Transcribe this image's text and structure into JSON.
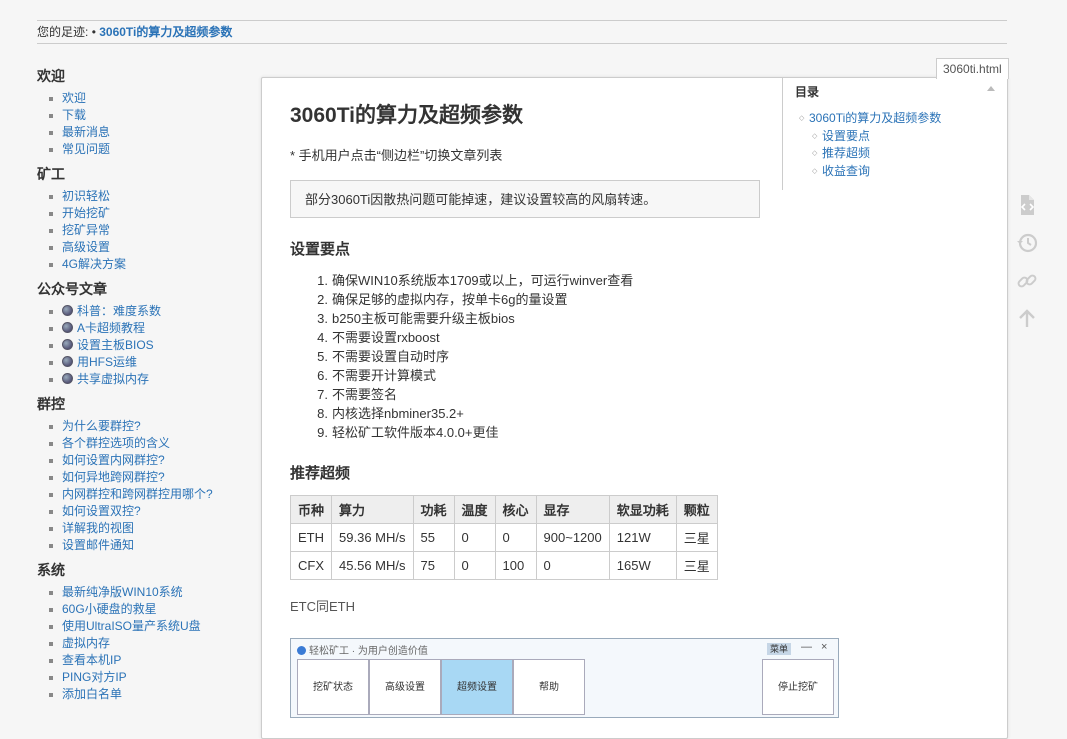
{
  "breadcrumb": {
    "label": "您的足迹:",
    "separator": "•",
    "current": "3060Ti的算力及超频参数"
  },
  "filename_tab": "3060ti.html",
  "sidebar": [
    {
      "heading": "欢迎",
      "items": [
        "欢迎",
        "下载",
        "最新消息",
        "常见问题"
      ]
    },
    {
      "heading": "矿工",
      "items": [
        "初识轻松",
        "开始挖矿",
        "挖矿异常",
        "高级设置",
        "4G解决方案"
      ]
    },
    {
      "heading": "公众号文章",
      "items": [
        "科普：难度系数",
        "A卡超频教程",
        "设置主板BIOS",
        "用HFS运维",
        "共享虚拟内存"
      ],
      "with_globe_icon": true
    },
    {
      "heading": "群控",
      "items": [
        "为什么要群控?",
        "各个群控选项的含义",
        "如何设置内网群控?",
        "如何异地跨网群控?",
        "内网群控和跨网群控用哪个?",
        "如何设置双控?",
        "详解我的视图",
        "设置邮件通知"
      ]
    },
    {
      "heading": "系统",
      "items": [
        "最新纯净版WIN10系统",
        "60G小硬盘的救星",
        "使用UltraISO量产系统U盘",
        "虚拟内存",
        "查看本机IP",
        "PING对方IP",
        "添加白名单"
      ]
    }
  ],
  "content": {
    "title": "3060Ti的算力及超频参数",
    "mobile_note": "* 手机用户点击“侧边栏”切换文章列表",
    "warning": "部分3060Ti因散热问题可能掉速，建议设置较高的风扇转速。",
    "section1_title": "设置要点",
    "settings_points": [
      "确保WIN10系统版本1709或以上，可运行winver查看",
      "确保足够的虚拟内存，按单卡6g的量设置",
      "b250主板可能需要升级主板bios",
      "不需要设置rxboost",
      "不需要设置自动时序",
      "不需要开计算模式",
      "不需要签名",
      "内核选择nbminer35.2+",
      "轻松矿工软件版本4.0.0+更佳"
    ],
    "section2_title": "推荐超频",
    "table": {
      "headers": [
        "币种",
        "算力",
        "功耗",
        "温度",
        "核心",
        "显存",
        "软显功耗",
        "颗粒"
      ],
      "rows": [
        [
          "ETH",
          "59.36 MH/s",
          "55",
          "0",
          "0",
          "900~1200",
          "121W",
          "三星"
        ],
        [
          "CFX",
          "45.56 MH/s",
          "75",
          "0",
          "100",
          "0",
          "165W",
          "三星"
        ]
      ]
    },
    "etc_note": "ETC同ETH"
  },
  "app_screenshot": {
    "title": "轻松矿工 · 为用户创造价值",
    "menu_label": "菜单",
    "minimize": "—",
    "close": "×",
    "tabs": [
      "挖矿状态",
      "高级设置",
      "超频设置",
      "帮助"
    ],
    "active_tab": "超频设置",
    "stop_button": "停止挖矿"
  },
  "toc": {
    "heading": "目录",
    "items": [
      {
        "label": "3060Ti的算力及超频参数",
        "level": 1
      },
      {
        "label": "设置要点",
        "level": 2
      },
      {
        "label": "推荐超频",
        "level": 2
      },
      {
        "label": "收益查询",
        "level": 2
      }
    ]
  },
  "page_tools": [
    "show-source-icon",
    "old-revisions-icon",
    "backlinks-icon",
    "back-to-top-icon"
  ]
}
